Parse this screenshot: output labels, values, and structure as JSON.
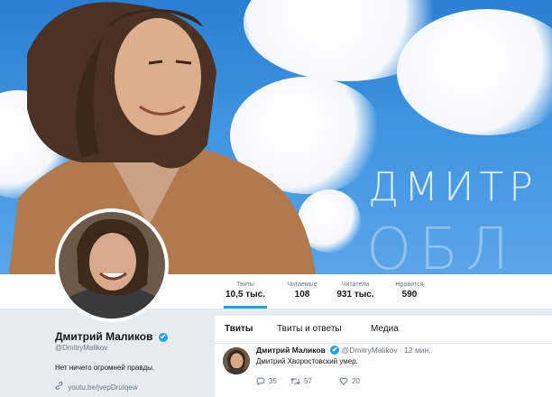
{
  "banner": {
    "text_line1": "ДМИТР",
    "text_line2": "ОБЛ"
  },
  "stats": [
    {
      "label": "Твиты",
      "value": "10,5 тыс."
    },
    {
      "label": "Читаемые",
      "value": "108"
    },
    {
      "label": "Читатели",
      "value": "931 тыс."
    },
    {
      "label": "Нравится",
      "value": "590"
    }
  ],
  "profile": {
    "name": "Дмитрий Маликов",
    "handle": "@DmitryMalikov",
    "bio": "Нет ничего огромней правды.",
    "link": "youtu.be/jvepDruIqew",
    "verified_icon": "✔"
  },
  "tabs": [
    {
      "label": "Твиты"
    },
    {
      "label": "Твиты и ответы"
    },
    {
      "label": "Медиа"
    }
  ],
  "tweet": {
    "name": "Дмитрий Маликов",
    "handle_time": "@DmitryMalikov · 12 мин.",
    "text": "Дмитрий Хворостовский умер.",
    "replies": "35",
    "retweets": "57",
    "likes": "20"
  },
  "colors": {
    "accent": "#1da1f2",
    "text": "#14171a",
    "muted": "#657786",
    "bg": "#e6ecf0"
  }
}
